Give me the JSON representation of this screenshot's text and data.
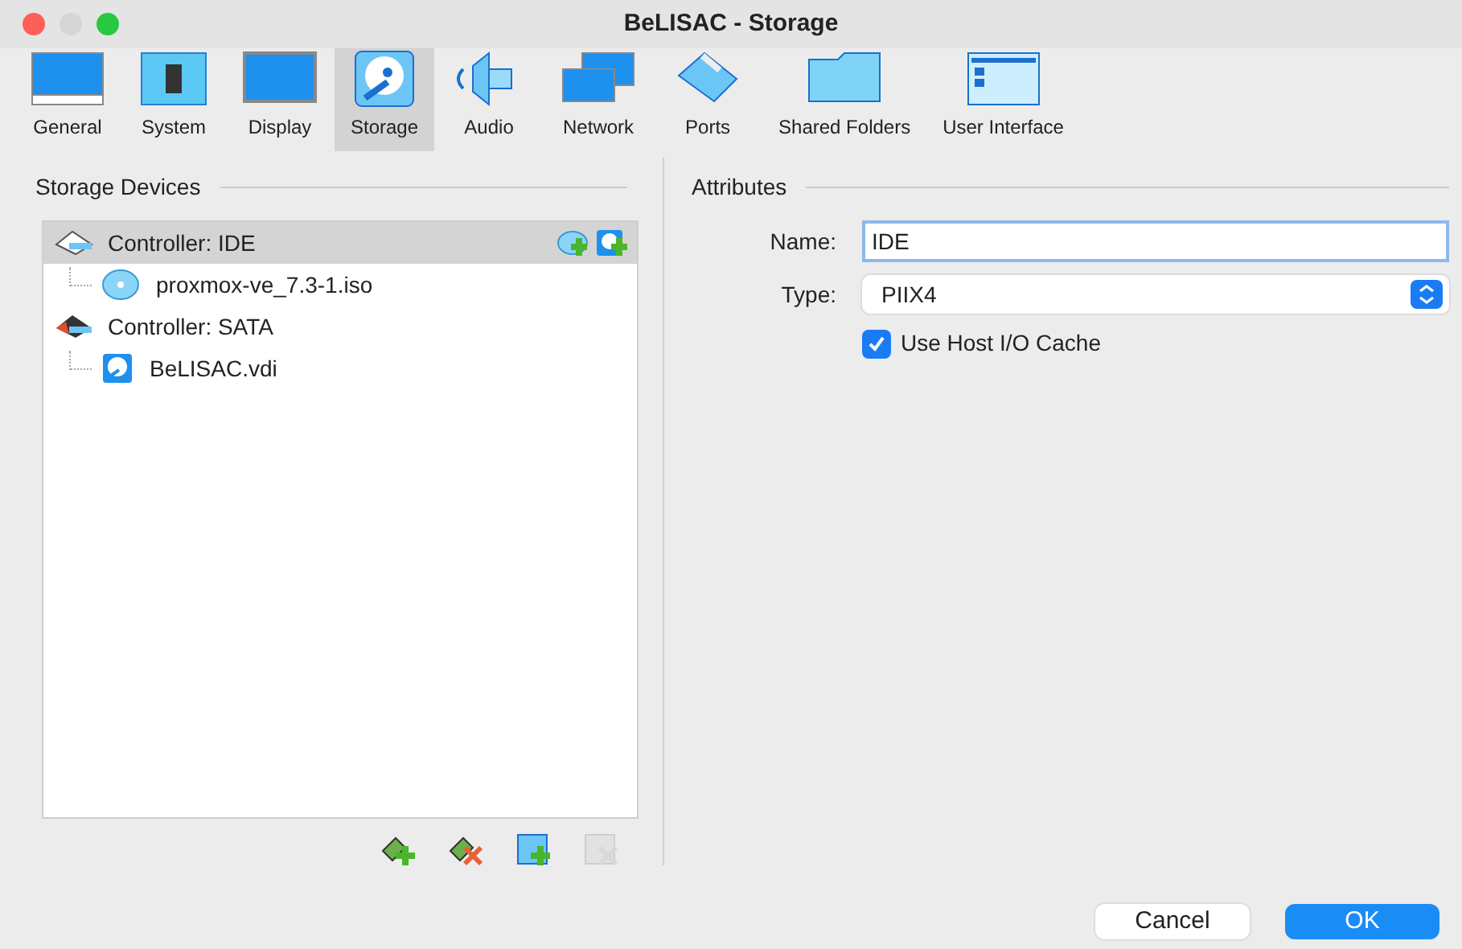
{
  "window": {
    "title": "BeLISAC - Storage"
  },
  "toolbar": [
    {
      "label": "General",
      "kind": "general",
      "selected": false
    },
    {
      "label": "System",
      "kind": "system",
      "selected": false
    },
    {
      "label": "Display",
      "kind": "display",
      "selected": false
    },
    {
      "label": "Storage",
      "kind": "storage",
      "selected": true
    },
    {
      "label": "Audio",
      "kind": "audio",
      "selected": false
    },
    {
      "label": "Network",
      "kind": "network",
      "selected": false
    },
    {
      "label": "Ports",
      "kind": "ports",
      "selected": false
    },
    {
      "label": "Shared Folders",
      "kind": "folders",
      "selected": false
    },
    {
      "label": "User Interface",
      "kind": "ui",
      "selected": false
    }
  ],
  "storage_devices": {
    "title": "Storage Devices",
    "tree": [
      {
        "label": "Controller: IDE",
        "kind": "ide",
        "selected": true,
        "children": [
          {
            "label": "proxmox-ve_7.3-1.iso",
            "kind": "optical",
            "selected": false
          }
        ]
      },
      {
        "label": "Controller: SATA",
        "kind": "sata",
        "selected": false,
        "children": [
          {
            "label": "BeLISAC.vdi",
            "kind": "disk",
            "selected": false
          }
        ]
      }
    ],
    "tools": [
      {
        "kind": "add-controller",
        "disabled": false
      },
      {
        "kind": "remove-controller",
        "disabled": false
      },
      {
        "kind": "add-attachment",
        "disabled": false
      },
      {
        "kind": "remove-attachment",
        "disabled": true
      }
    ]
  },
  "attributes": {
    "title": "Attributes",
    "name_label": "Name:",
    "name_value": "IDE",
    "type_label": "Type:",
    "type_value": "PIIX4",
    "host_cache": {
      "label": "Use Host I/O Cache",
      "checked": true
    }
  },
  "buttons": [
    {
      "label": "Cancel",
      "kind": "default"
    },
    {
      "label": "OK",
      "kind": "primary"
    }
  ]
}
